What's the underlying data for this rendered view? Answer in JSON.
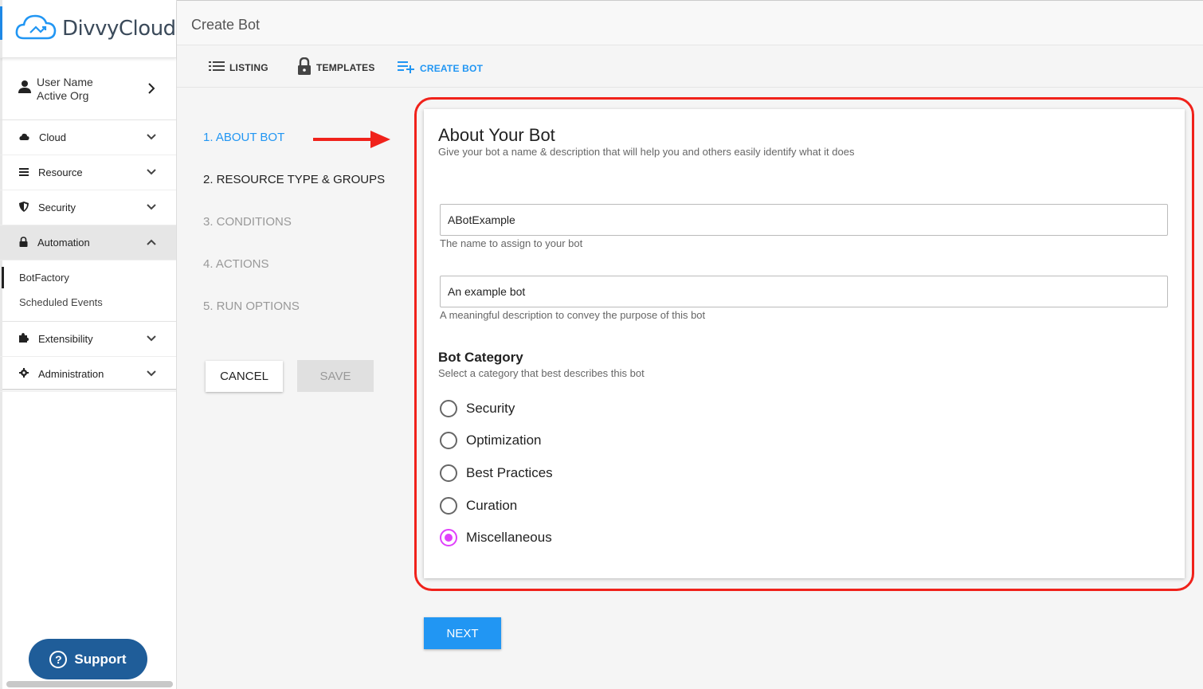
{
  "app": {
    "brand": "DivvyCloud",
    "header_title": "Create Bot"
  },
  "user": {
    "name": "User Name",
    "org": "Active Org"
  },
  "sidebar": {
    "items": [
      {
        "label": "Cloud"
      },
      {
        "label": "Resource"
      },
      {
        "label": "Security"
      },
      {
        "label": "Automation"
      },
      {
        "label": "Extensibility"
      },
      {
        "label": "Administration"
      }
    ],
    "automation_sub": [
      "BotFactory",
      "Scheduled Events"
    ]
  },
  "support_label": "Support",
  "tabs": [
    "LISTING",
    "TEMPLATES",
    "CREATE BOT"
  ],
  "steps": [
    "1. ABOUT BOT",
    "2. RESOURCE TYPE & GROUPS",
    "3. CONDITIONS",
    "4. ACTIONS",
    "5. RUN OPTIONS"
  ],
  "buttons": {
    "cancel": "CANCEL",
    "save": "SAVE",
    "next": "NEXT"
  },
  "card": {
    "title": "About Your Bot",
    "subtitle": "Give your bot a name & description that will help you and others easily identify what it does",
    "name_value": "ABotExample",
    "name_hint": "The name to assign to your bot",
    "desc_value": "An example bot",
    "desc_hint": "A meaningful description to convey the purpose of this bot",
    "category_title": "Bot Category",
    "category_sub": "Select a category that best describes this bot",
    "categories": [
      "Security",
      "Optimization",
      "Best Practices",
      "Curation",
      "Miscellaneous"
    ],
    "selected_category": "Miscellaneous"
  },
  "colors": {
    "accent": "#2196f3",
    "radio_selected": "#e040fb",
    "highlight_outline": "#f0221b",
    "support": "#1f5d99"
  }
}
